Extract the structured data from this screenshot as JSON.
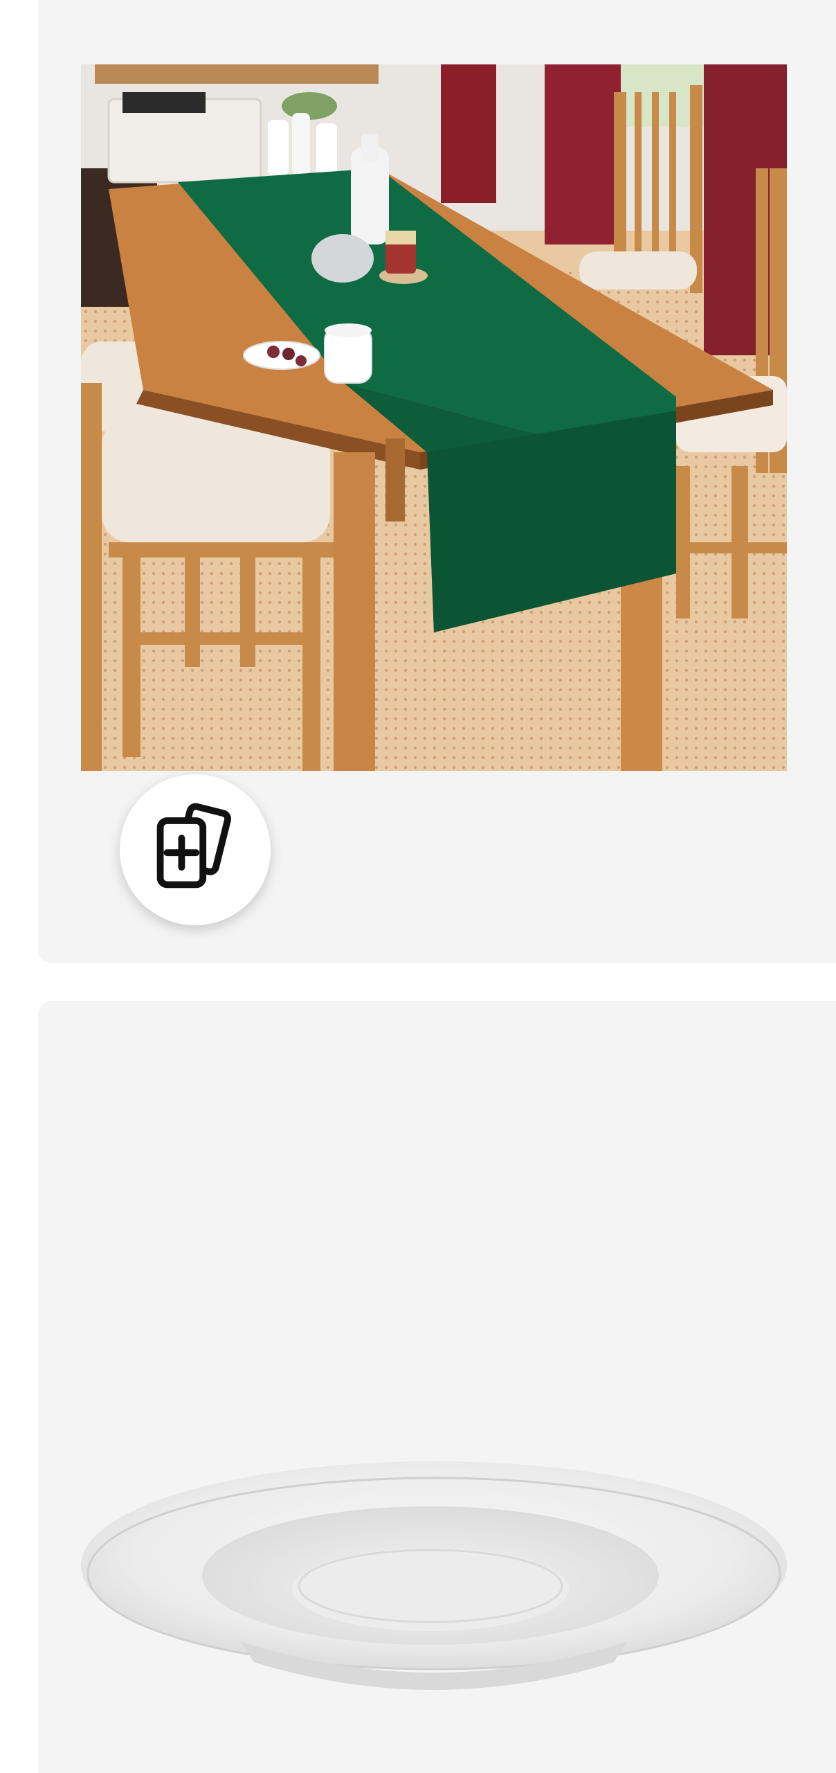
{
  "products": [
    {
      "image_alt": "",
      "compare_icon": "add-to-compare-icon"
    },
    {
      "image_alt": ""
    }
  ],
  "colors": {
    "card_background": "#f4f4f4",
    "page_background": "#ffffff",
    "runner_green": "#0e5a3a",
    "table_wood": "#c27a3e"
  }
}
